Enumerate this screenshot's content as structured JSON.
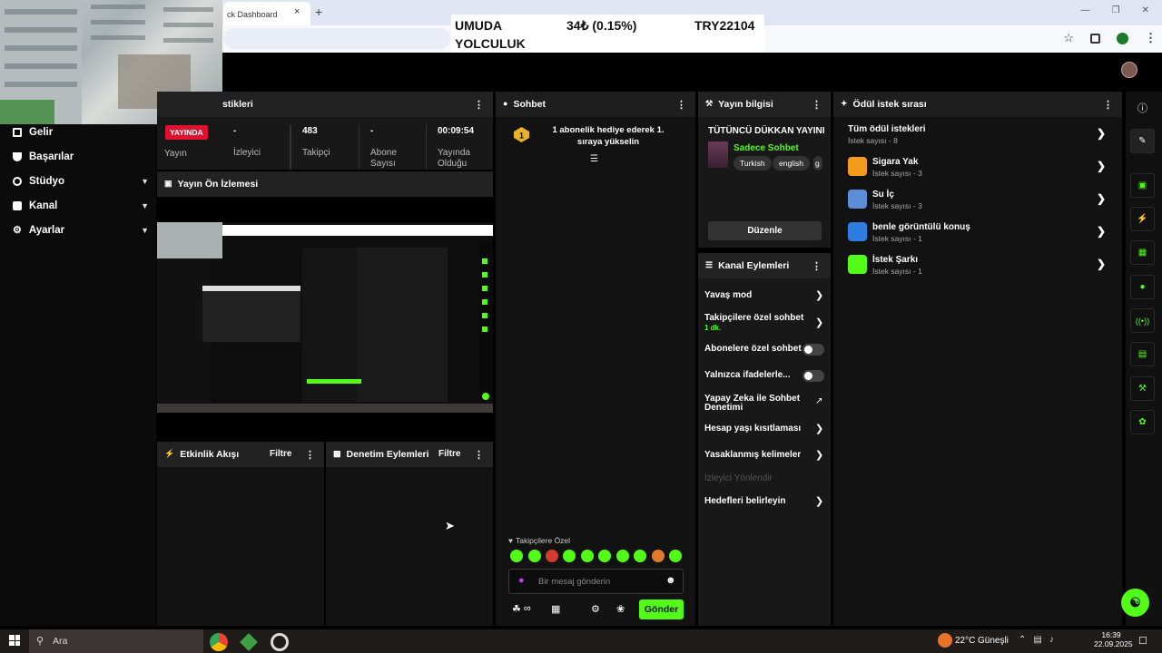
{
  "browser": {
    "tab_title": "ck Dashboard",
    "tab_close": "×",
    "new_tab": "+"
  },
  "ticker": {
    "name_line1": "UMUDA",
    "name_line2": "YOLCULUK",
    "price": "34₺ (0.15%)",
    "symbol": "TRY22104"
  },
  "sidebar": {
    "items": [
      {
        "label": "Gelir",
        "icon": "income-icon"
      },
      {
        "label": "Başarılar",
        "icon": "trophy-icon"
      },
      {
        "label": "Stüdyo",
        "icon": "studio-icon"
      },
      {
        "label": "Kanal",
        "icon": "channel-icon"
      },
      {
        "label": "Ayarlar",
        "icon": "gear-icon"
      }
    ]
  },
  "stats": {
    "panel_title": "stikleri",
    "live_badge": "YAYINDA",
    "status_label": "Yayın",
    "viewers_value": "-",
    "viewers_label": "İzleyici",
    "followers_value": "483",
    "followers_label": "Takipçi",
    "subs_value": "-",
    "subs_label": "Abone Sayısı",
    "uptime_value": "00:09:54",
    "uptime_label": "Yayında Olduğu"
  },
  "preview": {
    "title": "Yayın Ön İzlemesi"
  },
  "activity": {
    "title": "Etkinlik Akışı",
    "filter": "Filtre"
  },
  "moderation": {
    "title": "Denetim Eylemleri",
    "filter": "Filtre"
  },
  "chat": {
    "title": "Sohbet",
    "message": "1 abonelik hediye ederek 1. sıraya yükselin",
    "rank": "1",
    "followers_only": "Takipçilere Özel",
    "placeholder": "Bir mesaj gönderin",
    "send": "Gönder",
    "infinity": "∞"
  },
  "stream_info": {
    "title": "Yayın bilgisi",
    "stream_title": "TÜTÜNCÜ DÜKKAN YAYINI",
    "category": "Sadece Sohbet",
    "tags": [
      "Turkish",
      "english",
      "g"
    ],
    "edit": "Düzenle"
  },
  "channel_actions": {
    "title": "Kanal Eylemleri",
    "items": [
      {
        "label": "Yavaş mod",
        "type": "chevron"
      },
      {
        "label": "Takipçilere özel sohbet",
        "sub": "1 dk.",
        "type": "chevron"
      },
      {
        "label": "Abonelere özel sohbet",
        "type": "toggle"
      },
      {
        "label": "Yalnızca ifadelerle...",
        "type": "toggle"
      },
      {
        "label": "Yapay Zeka ile Sohbet Denetimi",
        "type": "external"
      },
      {
        "label": "Hesap yaşı kısıtlaması",
        "type": "chevron"
      },
      {
        "label": "Yasaklanmış kelimeler",
        "type": "chevron"
      },
      {
        "label": "İzleyici Yönlendir",
        "type": "disabled"
      },
      {
        "label": "Hedefleri belirleyin",
        "type": "chevron"
      }
    ]
  },
  "rewards": {
    "title": "Ödül istek sırası",
    "all_title": "Tüm ödül istekleri",
    "all_count": "İstek sayısı - 8",
    "items": [
      {
        "title": "Sigara Yak",
        "count": "İstek sayısı - 3",
        "color": "#f29b1d"
      },
      {
        "title": "Su İç",
        "count": "İstek sayısı - 3",
        "color": "#5b8ed6"
      },
      {
        "title": "benle görüntülü konuş",
        "count": "İstek sayısı - 1",
        "color": "#2f7de1"
      },
      {
        "title": "İstek Şarkı",
        "count": "İstek sayısı - 1",
        "color": "#53fc18"
      }
    ]
  },
  "taskbar": {
    "search": "Ara",
    "weather": "22°C",
    "weather_desc": "Güneşli",
    "time": "16:39",
    "date": "22.09.2025"
  },
  "colors": {
    "accent": "#53fc18",
    "live": "#e0102f"
  }
}
